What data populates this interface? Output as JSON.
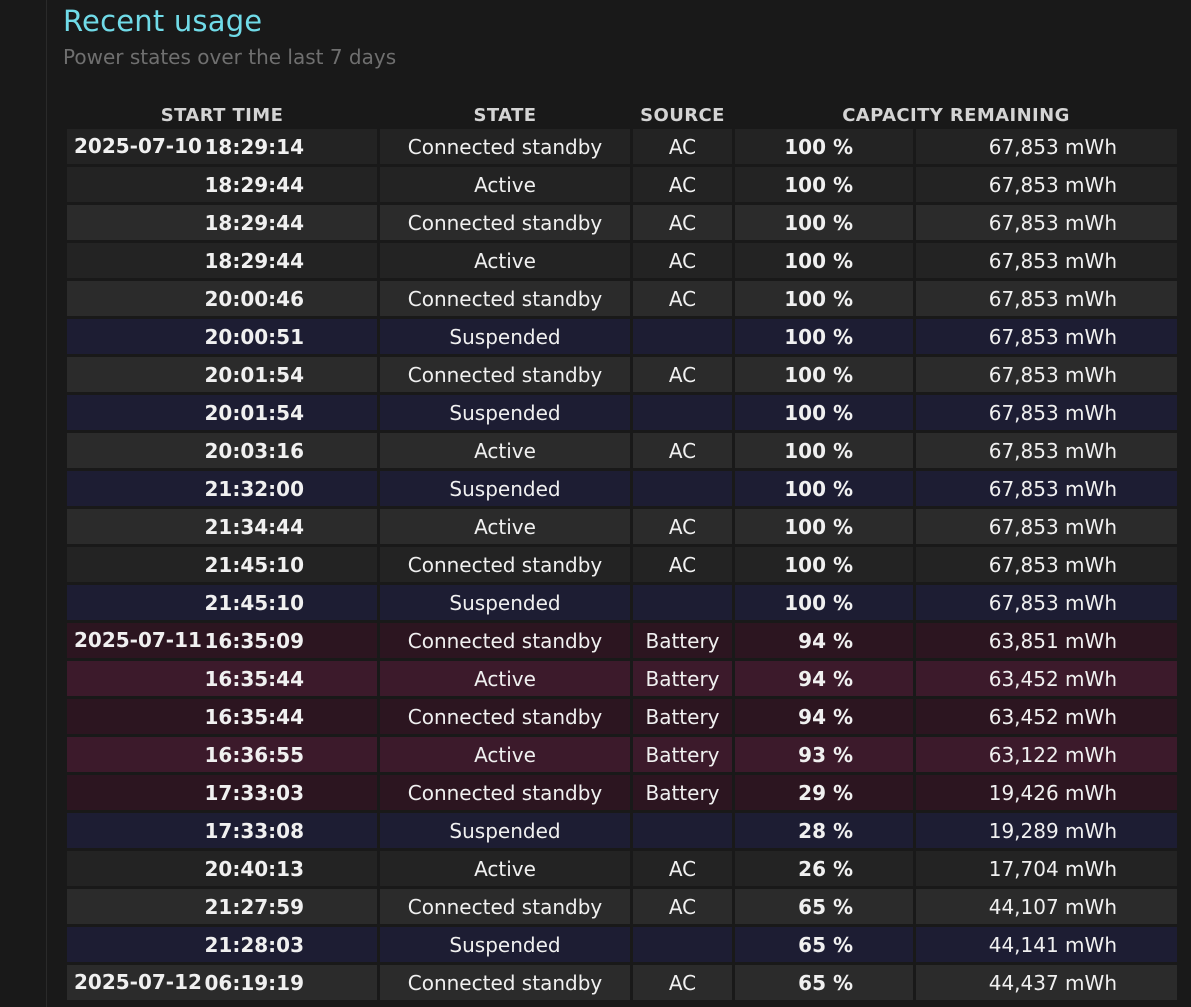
{
  "page": {
    "title": "Recent usage",
    "subtitle": "Power states over the last 7 days"
  },
  "table": {
    "headers": {
      "start_time": "START TIME",
      "state": "STATE",
      "source": "SOURCE",
      "capacity": "CAPACITY REMAINING"
    },
    "rows": [
      {
        "date": "2025-07-10",
        "time": "18:29:14",
        "state": "Connected standby",
        "source": "AC",
        "percent": "100 %",
        "mwh": "67,853 mWh",
        "kind": "ac-a"
      },
      {
        "date": "",
        "time": "18:29:44",
        "state": "Active",
        "source": "AC",
        "percent": "100 %",
        "mwh": "67,853 mWh",
        "kind": "ac-a"
      },
      {
        "date": "",
        "time": "18:29:44",
        "state": "Connected standby",
        "source": "AC",
        "percent": "100 %",
        "mwh": "67,853 mWh",
        "kind": "ac-b"
      },
      {
        "date": "",
        "time": "18:29:44",
        "state": "Active",
        "source": "AC",
        "percent": "100 %",
        "mwh": "67,853 mWh",
        "kind": "ac-a"
      },
      {
        "date": "",
        "time": "20:00:46",
        "state": "Connected standby",
        "source": "AC",
        "percent": "100 %",
        "mwh": "67,853 mWh",
        "kind": "ac-b"
      },
      {
        "date": "",
        "time": "20:00:51",
        "state": "Suspended",
        "source": "",
        "percent": "100 %",
        "mwh": "67,853 mWh",
        "kind": "sus"
      },
      {
        "date": "",
        "time": "20:01:54",
        "state": "Connected standby",
        "source": "AC",
        "percent": "100 %",
        "mwh": "67,853 mWh",
        "kind": "ac-b"
      },
      {
        "date": "",
        "time": "20:01:54",
        "state": "Suspended",
        "source": "",
        "percent": "100 %",
        "mwh": "67,853 mWh",
        "kind": "sus"
      },
      {
        "date": "",
        "time": "20:03:16",
        "state": "Active",
        "source": "AC",
        "percent": "100 %",
        "mwh": "67,853 mWh",
        "kind": "ac-b"
      },
      {
        "date": "",
        "time": "21:32:00",
        "state": "Suspended",
        "source": "",
        "percent": "100 %",
        "mwh": "67,853 mWh",
        "kind": "sus"
      },
      {
        "date": "",
        "time": "21:34:44",
        "state": "Active",
        "source": "AC",
        "percent": "100 %",
        "mwh": "67,853 mWh",
        "kind": "ac-b"
      },
      {
        "date": "",
        "time": "21:45:10",
        "state": "Connected standby",
        "source": "AC",
        "percent": "100 %",
        "mwh": "67,853 mWh",
        "kind": "ac-a"
      },
      {
        "date": "",
        "time": "21:45:10",
        "state": "Suspended",
        "source": "",
        "percent": "100 %",
        "mwh": "67,853 mWh",
        "kind": "sus"
      },
      {
        "date": "2025-07-11",
        "time": "16:35:09",
        "state": "Connected standby",
        "source": "Battery",
        "percent": "94 %",
        "mwh": "63,851 mWh",
        "kind": "bat-a"
      },
      {
        "date": "",
        "time": "16:35:44",
        "state": "Active",
        "source": "Battery",
        "percent": "94 %",
        "mwh": "63,452 mWh",
        "kind": "bat-b"
      },
      {
        "date": "",
        "time": "16:35:44",
        "state": "Connected standby",
        "source": "Battery",
        "percent": "94 %",
        "mwh": "63,452 mWh",
        "kind": "bat-a"
      },
      {
        "date": "",
        "time": "16:36:55",
        "state": "Active",
        "source": "Battery",
        "percent": "93 %",
        "mwh": "63,122 mWh",
        "kind": "bat-b"
      },
      {
        "date": "",
        "time": "17:33:03",
        "state": "Connected standby",
        "source": "Battery",
        "percent": "29 %",
        "mwh": "19,426 mWh",
        "kind": "bat-a"
      },
      {
        "date": "",
        "time": "17:33:08",
        "state": "Suspended",
        "source": "",
        "percent": "28 %",
        "mwh": "19,289 mWh",
        "kind": "sus"
      },
      {
        "date": "",
        "time": "20:40:13",
        "state": "Active",
        "source": "AC",
        "percent": "26 %",
        "mwh": "17,704 mWh",
        "kind": "ac-a"
      },
      {
        "date": "",
        "time": "21:27:59",
        "state": "Connected standby",
        "source": "AC",
        "percent": "65 %",
        "mwh": "44,107 mWh",
        "kind": "ac-b"
      },
      {
        "date": "",
        "time": "21:28:03",
        "state": "Suspended",
        "source": "",
        "percent": "65 %",
        "mwh": "44,141 mWh",
        "kind": "sus"
      },
      {
        "date": "2025-07-12",
        "time": "06:19:19",
        "state": "Connected standby",
        "source": "AC",
        "percent": "65 %",
        "mwh": "44,437 mWh",
        "kind": "ac-b"
      }
    ]
  }
}
